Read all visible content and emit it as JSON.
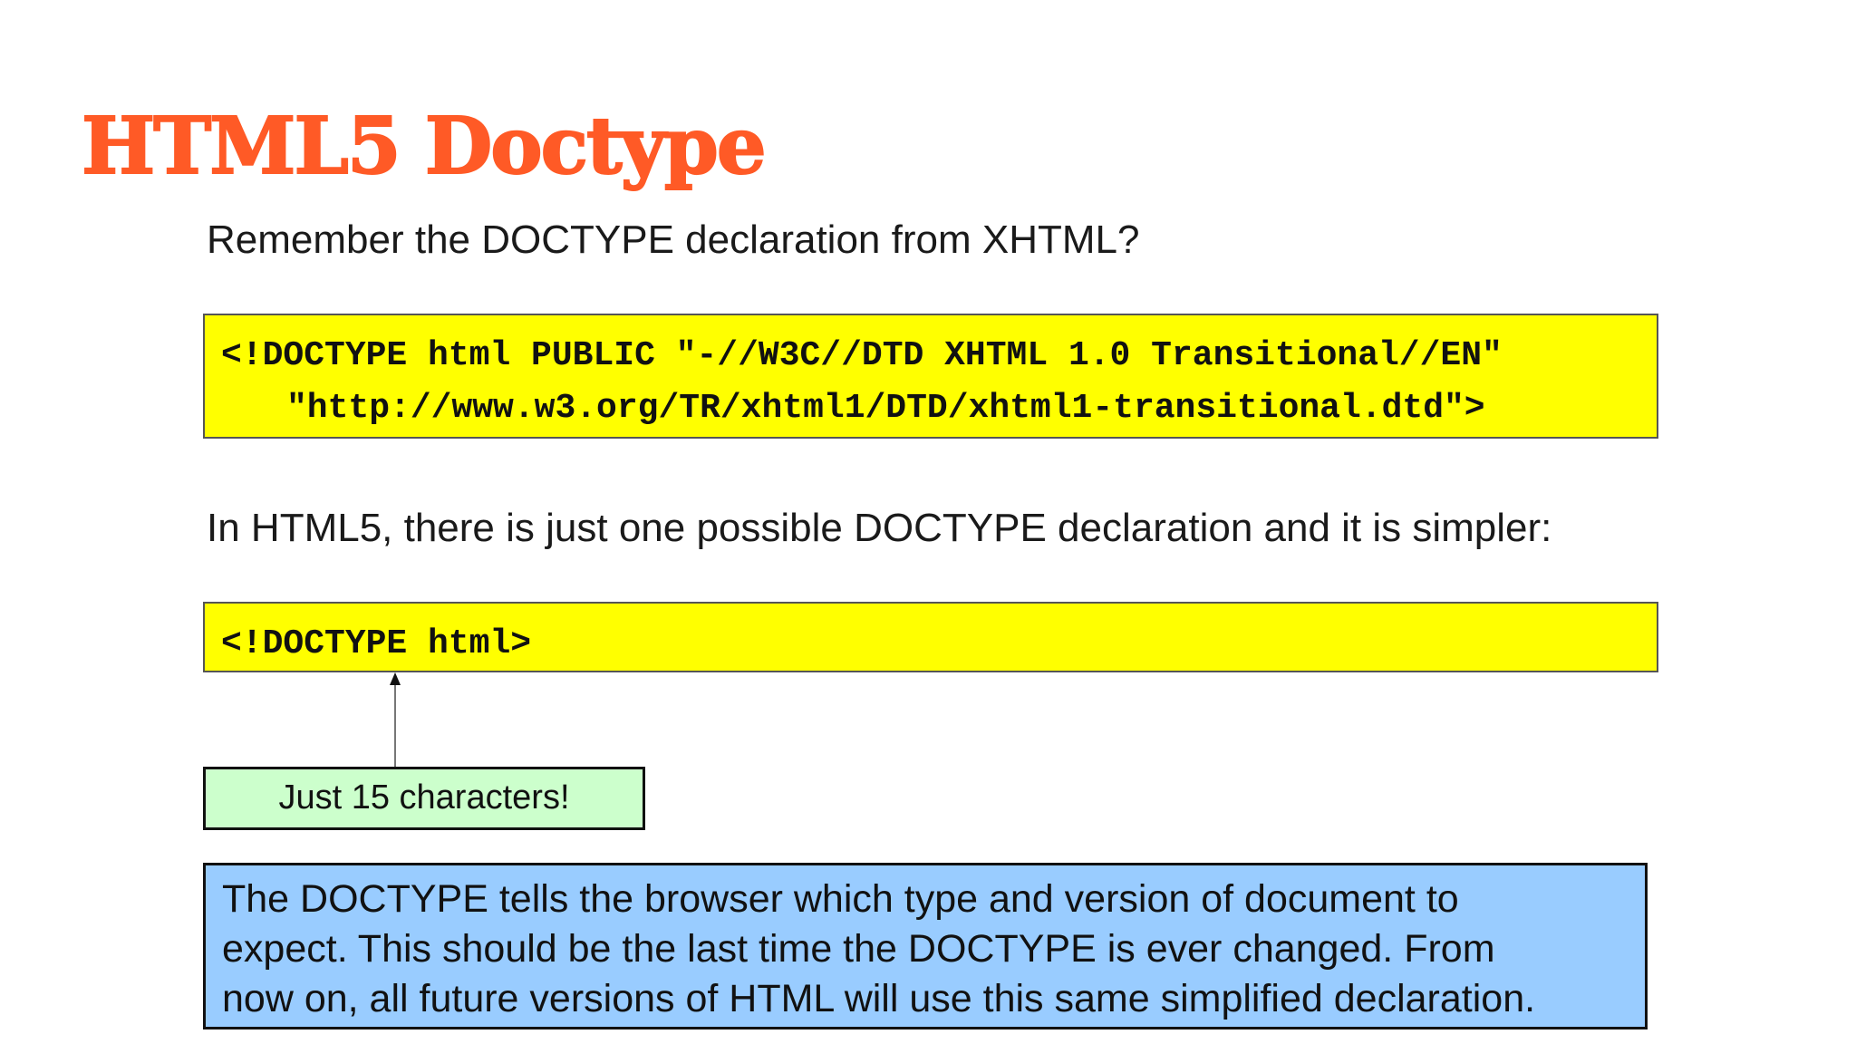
{
  "slide": {
    "title": "HTML5 Doctype",
    "intro_text": "Remember the DOCTYPE declaration from XHTML?",
    "xhtml_doctype": {
      "line1": "<!DOCTYPE html PUBLIC \"-//W3C//DTD XHTML 1.0 Transitional//EN\"",
      "line2": "\"http://www.w3.org/TR/xhtml1/DTD/xhtml1-transitional.dtd\">"
    },
    "html5_text": "In HTML5, there is just one possible DOCTYPE declaration and it is simpler:",
    "html5_doctype": "<!DOCTYPE html>",
    "callout": "Just 15 characters!",
    "note": {
      "line1": "The DOCTYPE tells the browser which type and version of document to",
      "line2": "expect.  This should be the last time the DOCTYPE is ever changed.  From",
      "line3": "now on, all future versions of HTML will use this same simplified declaration."
    }
  },
  "colors": {
    "title": "#ff5a26",
    "code_background": "#ffff00",
    "callout_background": "#ccffcc",
    "note_background": "#99ccff"
  }
}
